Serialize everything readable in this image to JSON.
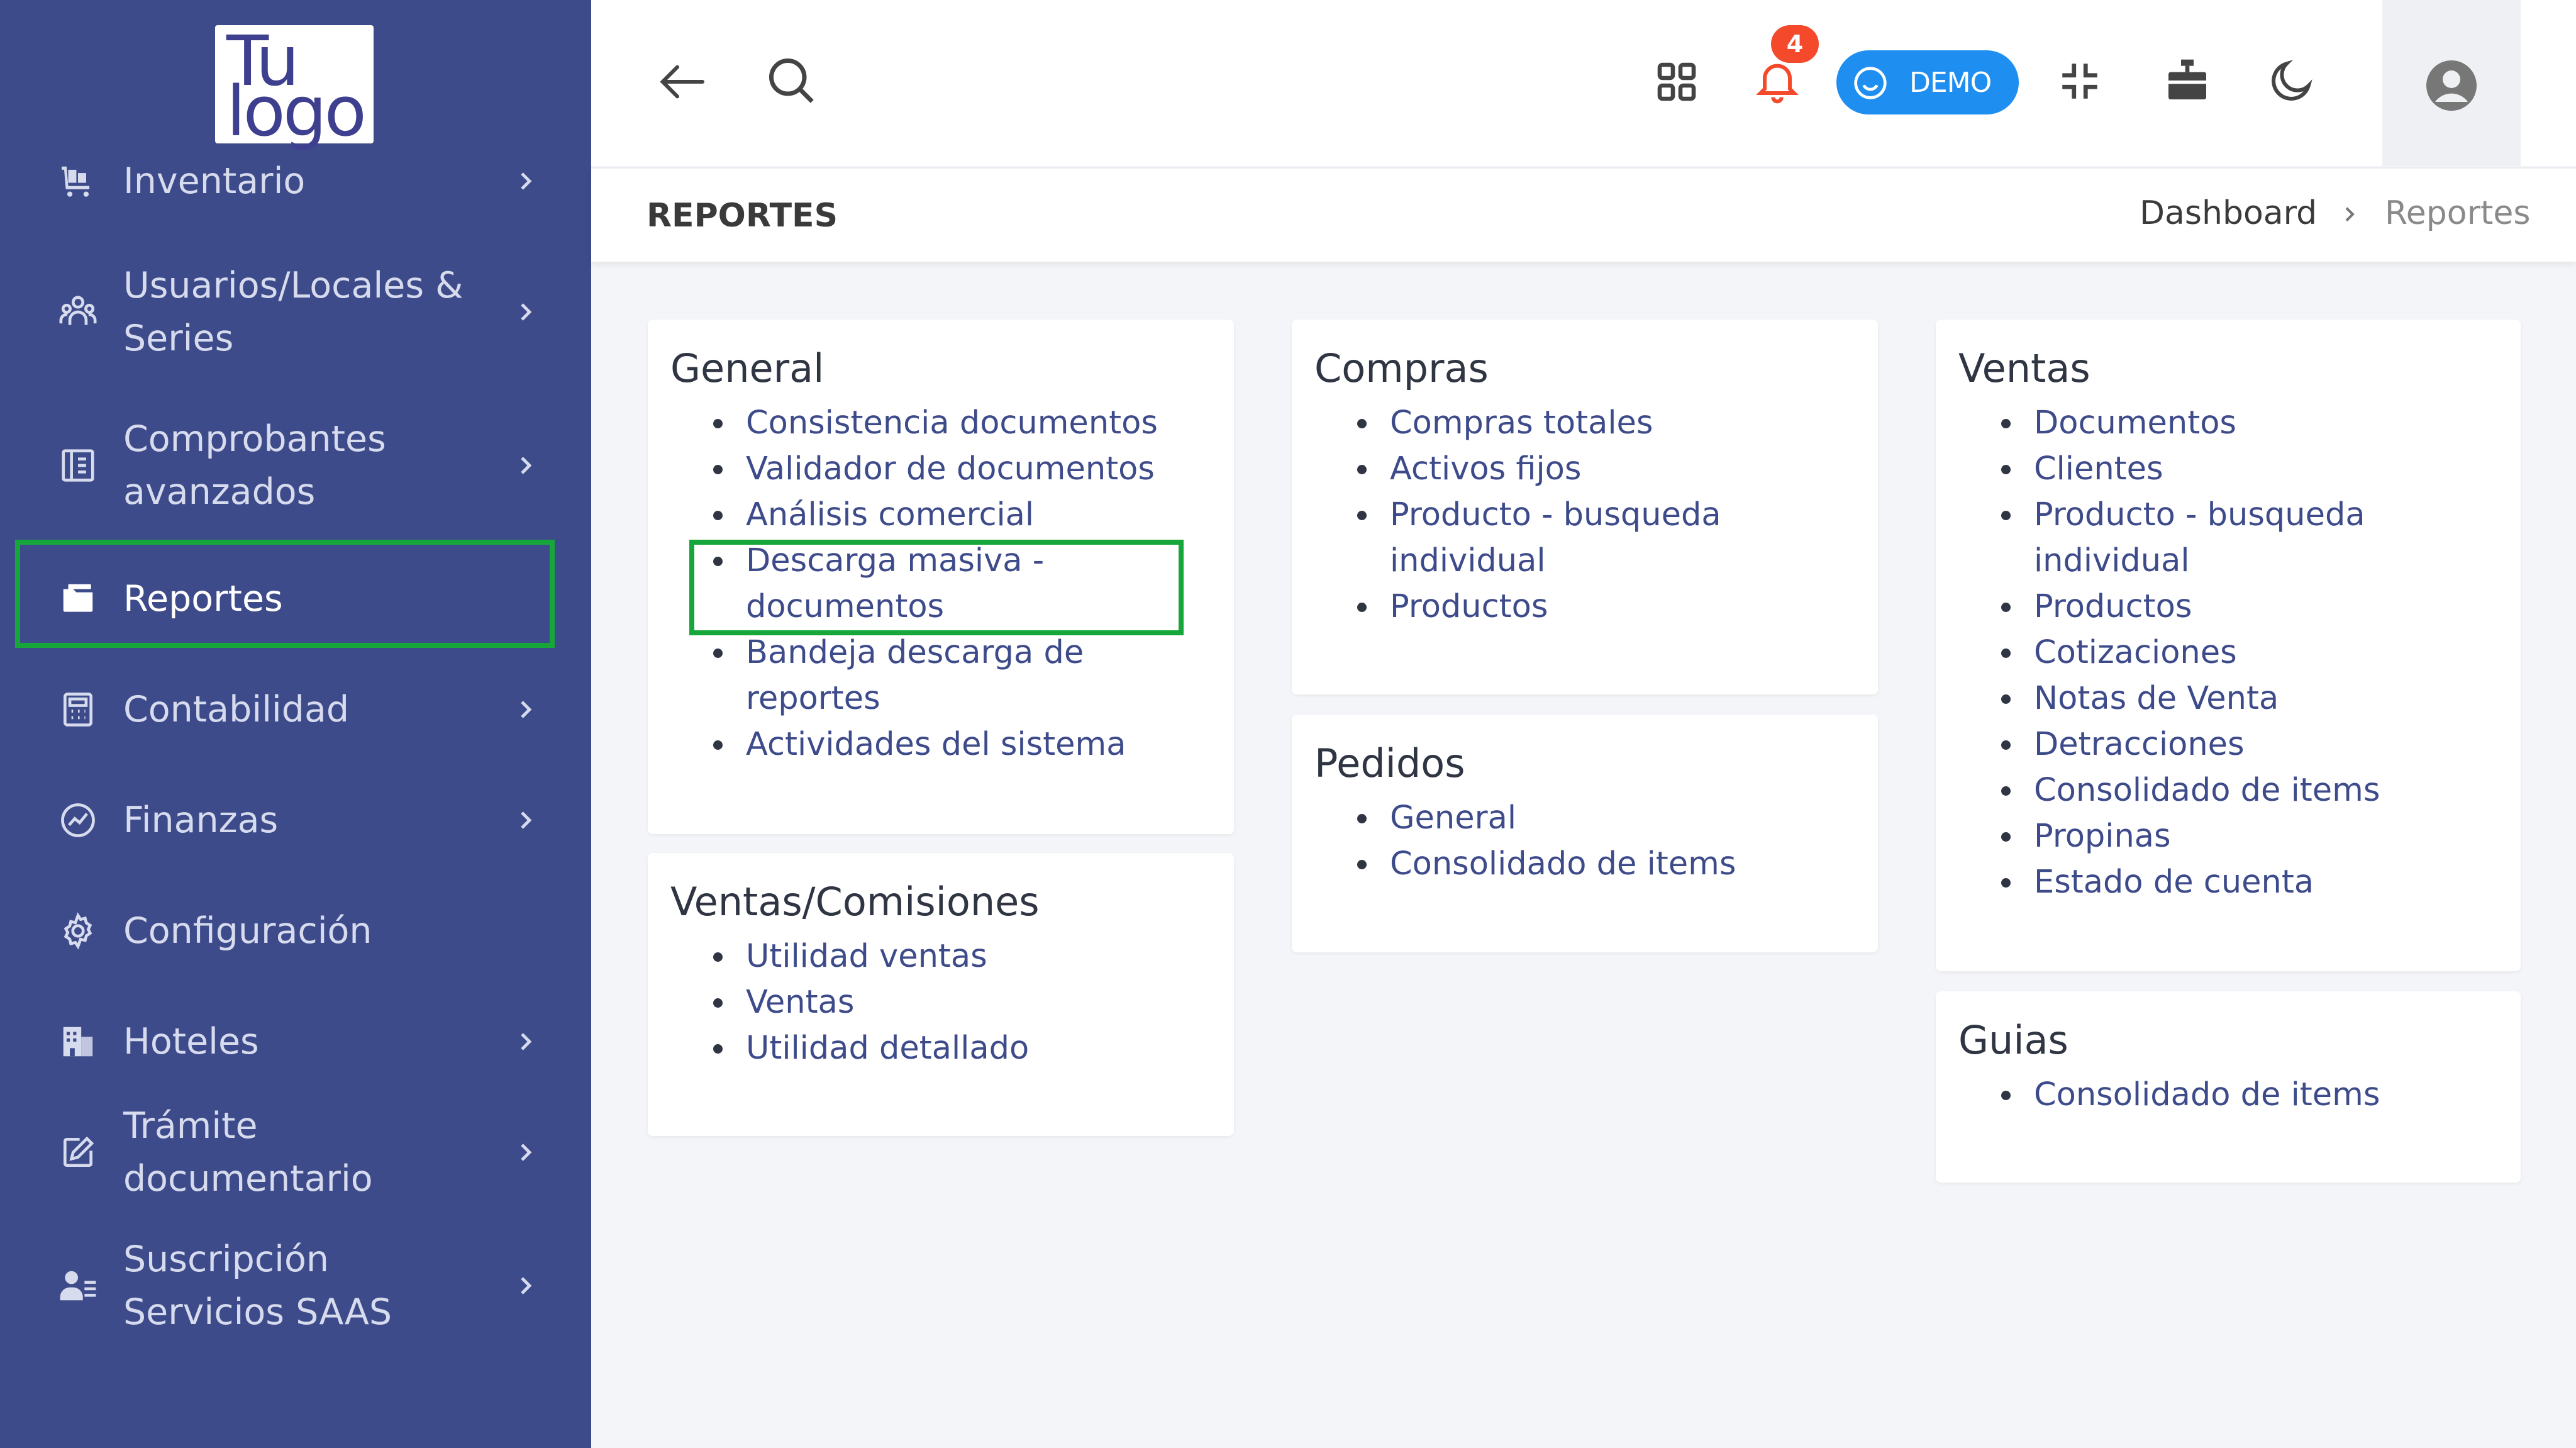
{
  "logo": {
    "line1": "Tu",
    "line2": "logo"
  },
  "sidebar": {
    "items": [
      {
        "label": "Inventario",
        "icon": "inventory-cart-icon",
        "chevron": true
      },
      {
        "label": "Usuarios/Locales & Series",
        "icon": "users-group-icon",
        "chevron": true
      },
      {
        "label": "Comprobantes avanzados",
        "icon": "receipt-icon",
        "chevron": true
      },
      {
        "label": "Reportes",
        "icon": "folder-icon",
        "chevron": false,
        "active": true
      },
      {
        "label": "Contabilidad",
        "icon": "calculator-icon",
        "chevron": true
      },
      {
        "label": "Finanzas",
        "icon": "finance-gauge-icon",
        "chevron": true
      },
      {
        "label": "Configuración",
        "icon": "gear-icon",
        "chevron": false
      },
      {
        "label": "Hoteles",
        "icon": "hotel-building-icon",
        "chevron": true
      },
      {
        "label": "Trámite documentario",
        "icon": "document-edit-icon",
        "chevron": true
      },
      {
        "label": "Suscripción Servicios SAAS",
        "icon": "user-list-icon",
        "chevron": true
      }
    ]
  },
  "header": {
    "notifications_count": "4",
    "demo_label": "DEMO",
    "icons": [
      "back-arrow-icon",
      "search-icon",
      "apps-grid-icon",
      "bell-icon",
      "compress-icon",
      "cash-register-icon",
      "moon-icon",
      "user-circle-icon"
    ]
  },
  "subheader": {
    "title": "REPORTES",
    "breadcrumb": [
      "Dashboard",
      "Reportes"
    ]
  },
  "cards": {
    "general": {
      "title": "General",
      "items": [
        "Consistencia documentos",
        "Validador de documentos",
        "Análisis comercial",
        "Descarga masiva - documentos",
        "Bandeja descarga de reportes",
        "Actividades del sistema"
      ]
    },
    "ventas_comisiones": {
      "title": "Ventas/Comisiones",
      "items": [
        "Utilidad ventas",
        "Ventas",
        "Utilidad detallado"
      ]
    },
    "compras": {
      "title": "Compras",
      "items": [
        "Compras totales",
        "Activos fijos",
        "Producto - busqueda individual",
        "Productos"
      ]
    },
    "pedidos": {
      "title": "Pedidos",
      "items": [
        "General",
        "Consolidado de items"
      ]
    },
    "ventas": {
      "title": "Ventas",
      "items": [
        "Documentos",
        "Clientes",
        "Producto - busqueda individual",
        "Productos",
        "Cotizaciones",
        "Notas de Venta",
        "Detracciones",
        "Consolidado de items",
        "Propinas",
        "Estado de cuenta"
      ]
    },
    "guias": {
      "title": "Guias",
      "items": [
        "Consolidado de items"
      ]
    }
  },
  "colors": {
    "sidebar_bg": "#3e4b8a",
    "link": "#3e4b8a",
    "highlight": "#17a63a",
    "demo_pill": "#1f8ef1",
    "badge": "#f4492a"
  }
}
